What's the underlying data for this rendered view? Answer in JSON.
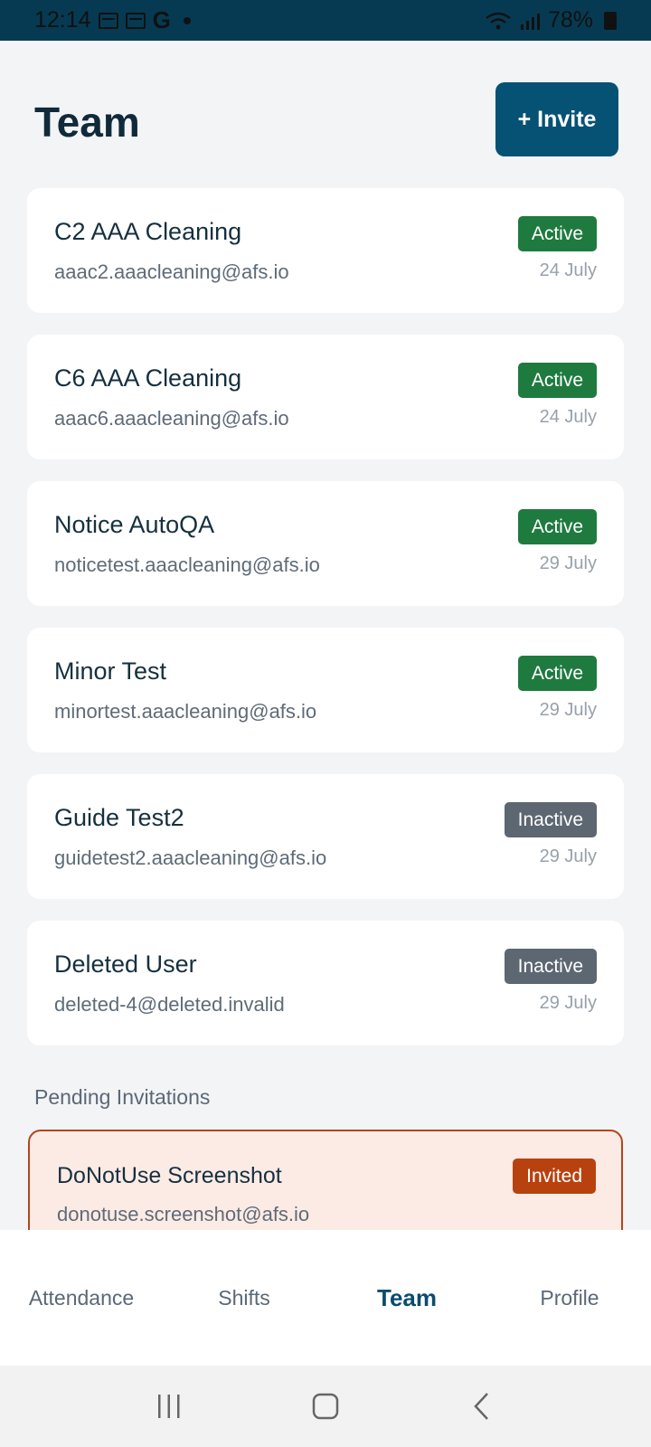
{
  "status_bar": {
    "time": "12:14",
    "g_label": "G",
    "battery": "78%"
  },
  "header": {
    "title": "Team",
    "invite_label": "+ Invite"
  },
  "members": [
    {
      "name": "C2 AAA Cleaning",
      "email": "aaac2.aaacleaning@afs.io",
      "status": "Active",
      "date": "24 July"
    },
    {
      "name": "C6 AAA Cleaning",
      "email": "aaac6.aaacleaning@afs.io",
      "status": "Active",
      "date": "24 July"
    },
    {
      "name": "Notice AutoQA",
      "email": "noticetest.aaacleaning@afs.io",
      "status": "Active",
      "date": "29 July"
    },
    {
      "name": "Minor Test",
      "email": "minortest.aaacleaning@afs.io",
      "status": "Active",
      "date": "29 July"
    },
    {
      "name": "Guide Test2",
      "email": "guidetest2.aaacleaning@afs.io",
      "status": "Inactive",
      "date": "29 July"
    },
    {
      "name": "Deleted User",
      "email": "deleted-4@deleted.invalid",
      "status": "Inactive",
      "date": "29 July"
    }
  ],
  "pending": {
    "heading": "Pending Invitations",
    "items": [
      {
        "name": "DoNotUse Screenshot",
        "email": "donotuse.screenshot@afs.io",
        "status": "Invited"
      }
    ]
  },
  "bottom_nav": {
    "items": [
      {
        "label": "Attendance",
        "active": false
      },
      {
        "label": "Shifts",
        "active": false
      },
      {
        "label": "Team",
        "active": true
      },
      {
        "label": "Profile",
        "active": false
      }
    ]
  },
  "colors": {
    "primary": "#065274",
    "active_badge": "#1f7a3f",
    "inactive_badge": "#5d6772",
    "invited_badge": "#b8420f"
  }
}
